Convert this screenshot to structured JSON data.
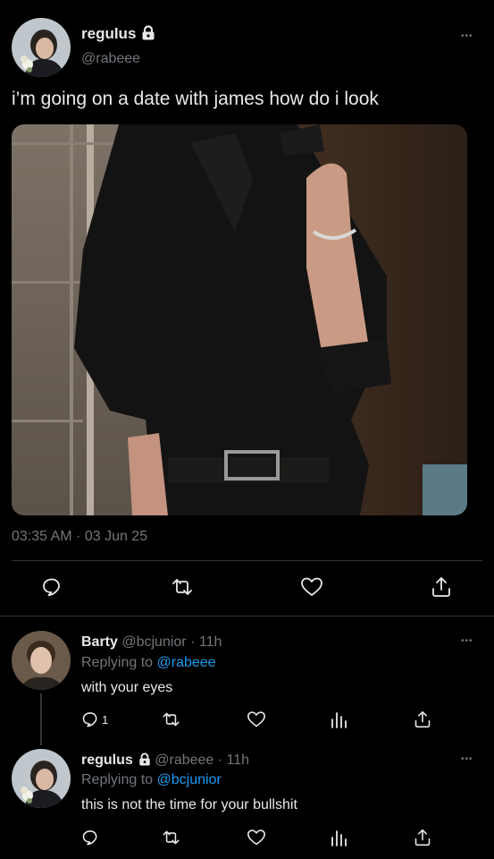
{
  "colors": {
    "background": "#000000",
    "text": "#e7e9ea",
    "muted": "#71767b",
    "link": "#1d9bf0",
    "divider": "#2f3336"
  },
  "main_tweet": {
    "display_name": "regulus",
    "handle": "@rabeee",
    "locked_icon": "lock-icon",
    "text": "i’m going on a date with james how do i look",
    "timestamp": "03:35 AM · 03 Jun 25",
    "actions": [
      "reply-icon",
      "retweet-icon",
      "like-icon",
      "share-icon"
    ]
  },
  "replies": [
    {
      "display_name": "Barty",
      "meta": "@bcjunior · 11h",
      "replying_label": "Replying to",
      "replying_to": "@rabeee",
      "text": "with your eyes",
      "reply_count": "1"
    },
    {
      "display_name": "regulus",
      "meta": "@rabeee · 11h",
      "replying_label": "Replying to",
      "replying_to": "@bcjunior",
      "text": "this is not the time for your bullshit"
    }
  ],
  "more_label": "•••"
}
